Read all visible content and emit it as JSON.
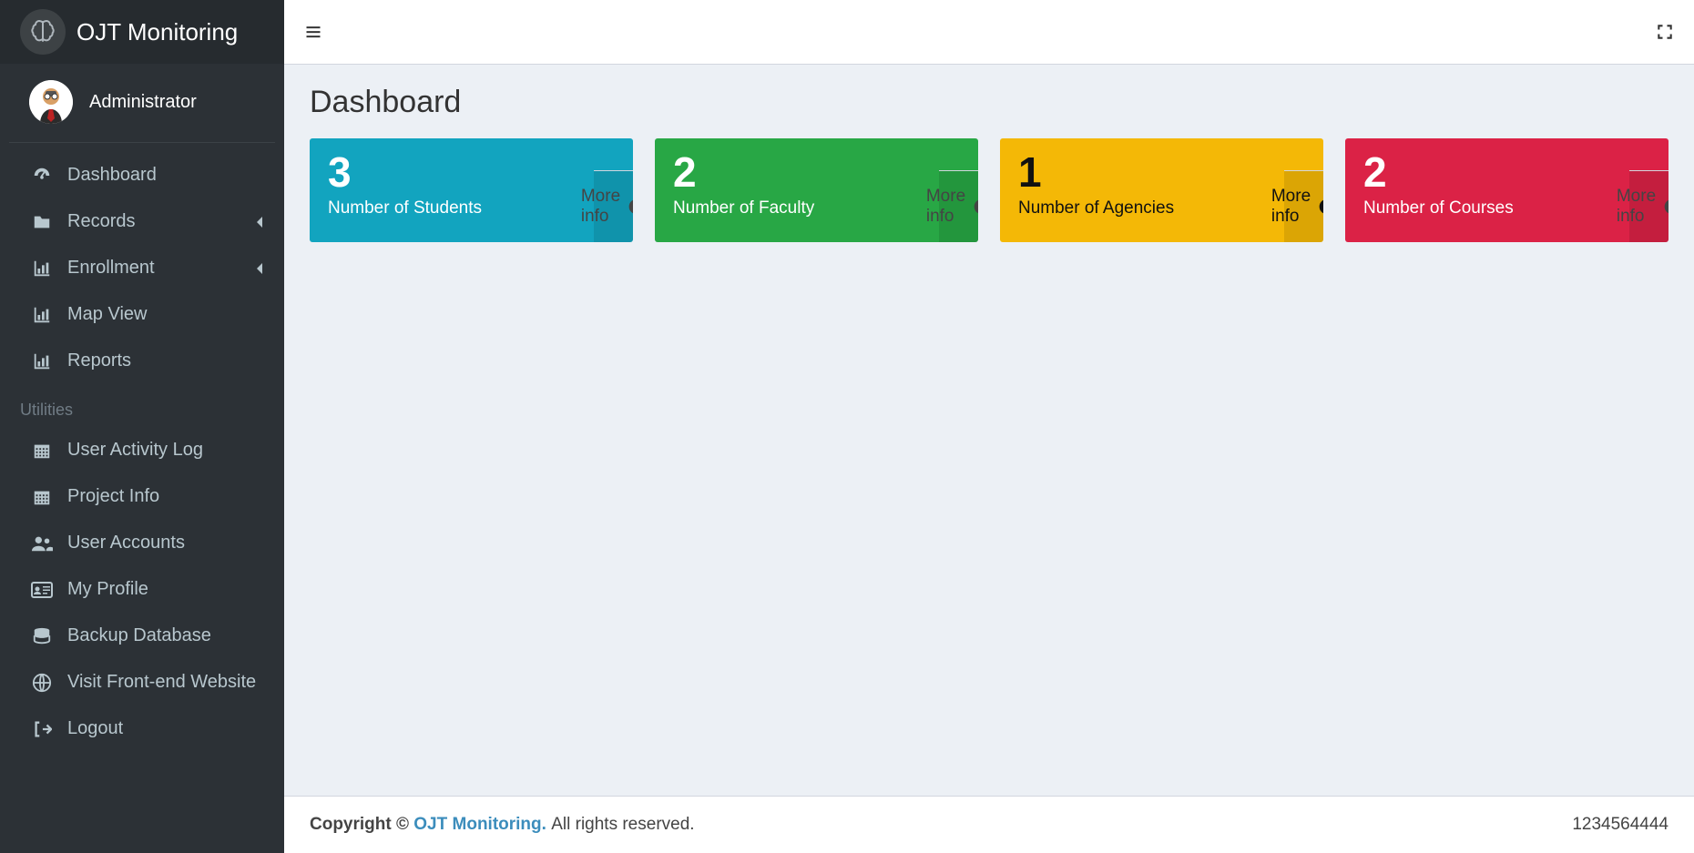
{
  "app": {
    "title": "OJT Monitoring"
  },
  "user": {
    "name": "Administrator"
  },
  "sidebar": {
    "items": [
      {
        "icon": "dashboard",
        "label": "Dashboard"
      },
      {
        "icon": "folder",
        "label": "Records",
        "hasChildren": true
      },
      {
        "icon": "bar-chart",
        "label": "Enrollment",
        "hasChildren": true
      },
      {
        "icon": "bar-chart",
        "label": "Map View"
      },
      {
        "icon": "bar-chart",
        "label": "Reports"
      }
    ],
    "utilitiesHeader": "Utilities",
    "utilities": [
      {
        "icon": "building",
        "label": "User Activity Log"
      },
      {
        "icon": "building",
        "label": "Project Info"
      },
      {
        "icon": "users",
        "label": "User Accounts"
      },
      {
        "icon": "id-card",
        "label": "My Profile"
      },
      {
        "icon": "database",
        "label": "Backup Database"
      },
      {
        "icon": "globe",
        "label": "Visit Front-end Website"
      },
      {
        "icon": "sign-out",
        "label": "Logout"
      }
    ]
  },
  "page": {
    "title": "Dashboard"
  },
  "stats": [
    {
      "value": "3",
      "label": "Number of Students",
      "color": "aqua",
      "link": "More info"
    },
    {
      "value": "2",
      "label": "Number of Faculty",
      "color": "green",
      "link": "More info"
    },
    {
      "value": "1",
      "label": "Number of Agencies",
      "color": "yellow",
      "link": "More info"
    },
    {
      "value": "2",
      "label": "Number of Courses",
      "color": "red",
      "link": "More info"
    }
  ],
  "footer": {
    "copyright": "Copyright © ",
    "brand": "OJT Monitoring.",
    "rights": " All rights reserved.",
    "version": "1234564444"
  }
}
